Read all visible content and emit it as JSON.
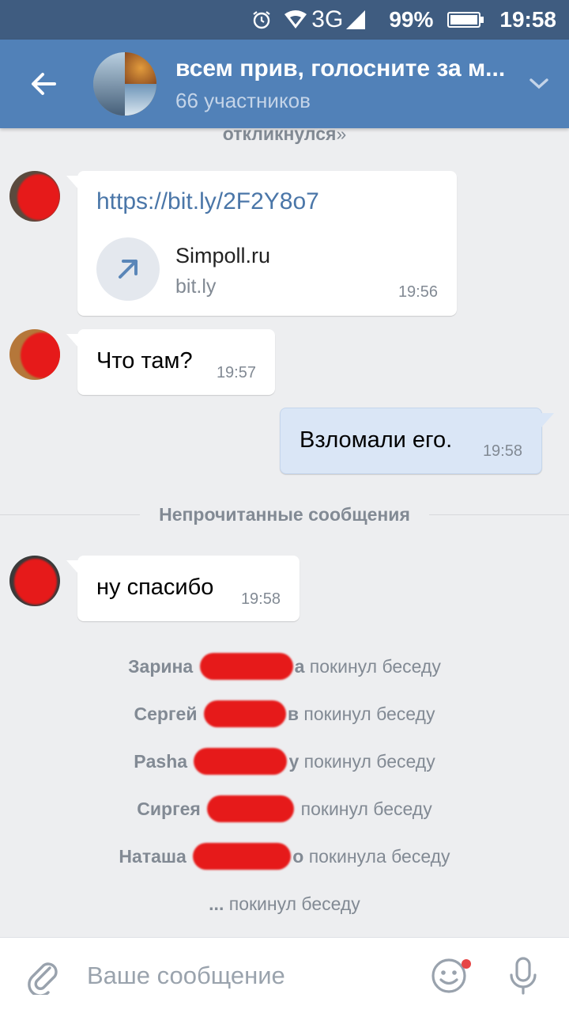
{
  "status_bar": {
    "network": "3G",
    "battery_percent": "99%",
    "time": "19:58",
    "icons": [
      "alarm-icon",
      "wifi-icon",
      "signal-icon",
      "battery-charging-icon"
    ]
  },
  "header": {
    "title": "всем прив, голосните за м...",
    "subtitle": "66 участников",
    "back_icon": "arrow-left-icon",
    "dropdown_icon": "chevron-down-icon"
  },
  "service_top": {
    "bold": "откликнулся",
    "rest": "»"
  },
  "messages": [
    {
      "direction": "in",
      "link": "https://bit.ly/2F2Y8o7",
      "attachment": {
        "title": "Simpoll.ru",
        "subtitle": "bit.ly",
        "icon": "arrow-up-right-icon"
      },
      "time": "19:56"
    },
    {
      "direction": "in",
      "text": "Что там?",
      "time": "19:57"
    },
    {
      "direction": "out",
      "text": "Взломали его.",
      "time": "19:58"
    },
    {
      "direction": "in",
      "text": "ну спасибо",
      "time": "19:58"
    }
  ],
  "divider_label": "Непрочитанные сообщения",
  "service_messages": [
    {
      "name_visible": "Зарина",
      "suffix_visible": "а",
      "action": "покинул беседу"
    },
    {
      "name_visible": "Сергей",
      "suffix_visible": "в",
      "action": "покинул беседу"
    },
    {
      "name_visible": "Pasha",
      "suffix_visible": "y",
      "action": "покинул беседу"
    },
    {
      "name_visible": "Сиргея",
      "suffix_visible": "",
      "action": "покинул беседу"
    },
    {
      "name_visible": "Наташа",
      "suffix_visible": "о",
      "action": "покинула беседу"
    },
    {
      "name_visible": "...",
      "suffix_visible": "",
      "action": "покинул беседу"
    }
  ],
  "input_bar": {
    "placeholder": "Ваше сообщение",
    "attach_icon": "paperclip-icon",
    "emoji_icon": "smile-icon",
    "mic_icon": "microphone-icon"
  },
  "colors": {
    "header_bg": "#5181b8",
    "status_bg": "#3f5c80",
    "chat_bg": "#edeef0",
    "link": "#4a76a8",
    "out_bubble": "#dae6f6",
    "redaction": "#e61a1a"
  }
}
